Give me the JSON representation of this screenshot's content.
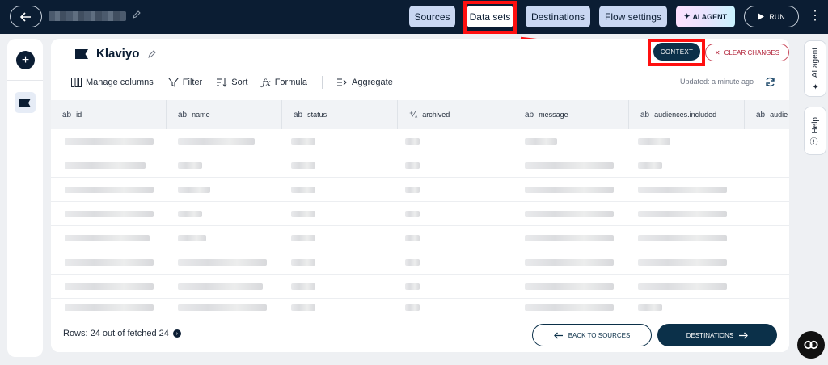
{
  "topbar": {
    "tabs": [
      {
        "label": "Sources"
      },
      {
        "label": "Data sets"
      },
      {
        "label": "Destinations"
      },
      {
        "label": "Flow settings"
      }
    ],
    "ai_agent_label": "AI AGENT",
    "run_label": "RUN",
    "active_tab": "Data sets"
  },
  "dataset": {
    "name": "Klaviyo",
    "context_label": "CONTEXT",
    "clear_label": "CLEAR CHANGES"
  },
  "toolbar": {
    "manage_columns": "Manage columns",
    "filter": "Filter",
    "sort": "Sort",
    "formula": "Formula",
    "aggregate": "Aggregate",
    "updated": "Updated: a minute ago"
  },
  "columns": [
    {
      "type": "ab",
      "name": "id"
    },
    {
      "type": "ab",
      "name": "name"
    },
    {
      "type": "ab",
      "name": "status"
    },
    {
      "type": "⁺⁄ₓ",
      "name": "archived"
    },
    {
      "type": "ab",
      "name": "message"
    },
    {
      "type": "ab",
      "name": "audiences.included"
    },
    {
      "type": "ab",
      "name": "audie"
    }
  ],
  "footer": {
    "rows_text": "Rows: 24 out of fetched 24",
    "back_label": "BACK TO SOURCES",
    "next_label": "DESTINATIONS"
  },
  "right_rail": {
    "ai_agent": "AI agent",
    "help": "Help"
  },
  "colors": {
    "topbar_bg": "#0b1d33",
    "tab_bg": "#c9d7f2",
    "primary": "#0b3049",
    "annotation_red": "#ff1010",
    "danger": "#b01e35"
  }
}
